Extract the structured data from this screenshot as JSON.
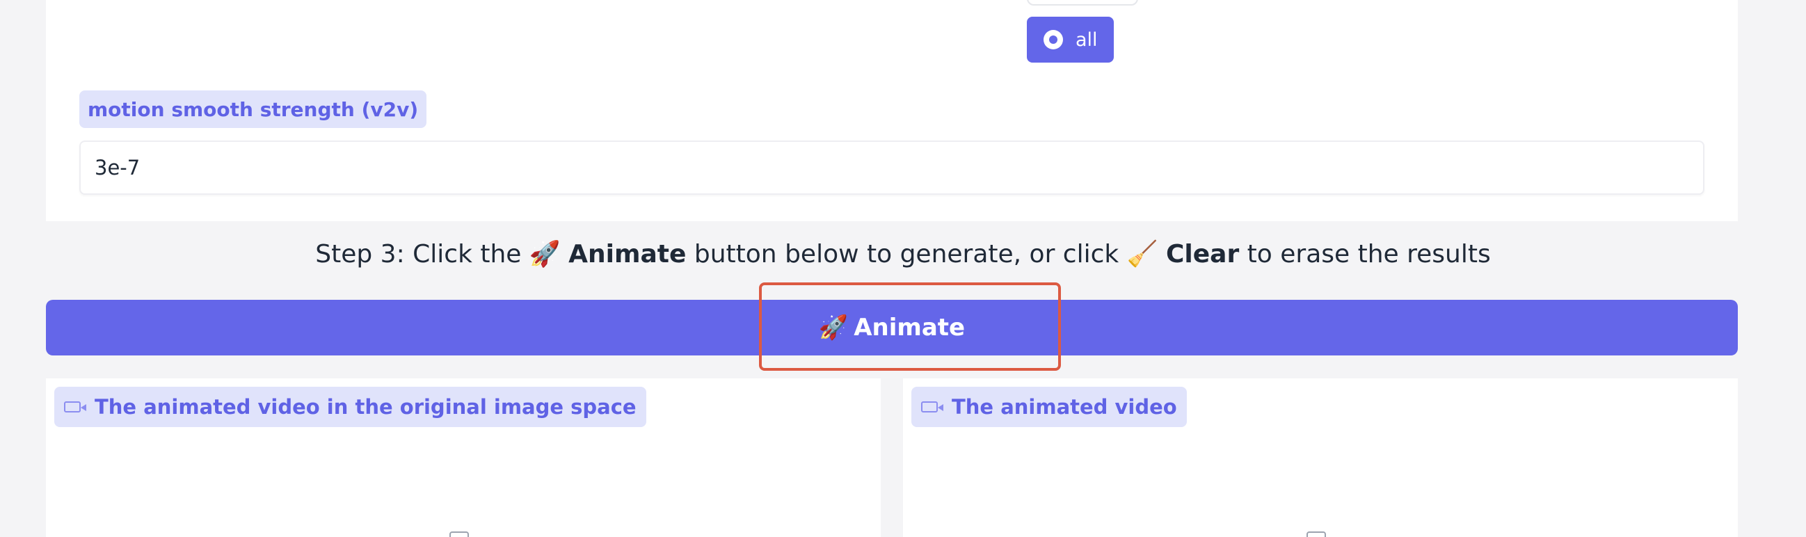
{
  "options": {
    "selected_label": "all"
  },
  "motion_smooth": {
    "label": "motion smooth strength (v2v)",
    "value": "3e-7"
  },
  "step3": {
    "prefix": "Step 3: Click the ",
    "animate_emoji": "🚀",
    "animate_word": "Animate",
    "middle": " button below to generate, or click ",
    "clear_emoji": "🧹",
    "clear_word": "Clear",
    "suffix": " to erase the results"
  },
  "animate_button": {
    "emoji": "🚀",
    "label": "Animate"
  },
  "outputs": {
    "left_label": "The animated video in the original image space",
    "right_label": "The animated video"
  },
  "colors": {
    "accent": "#6466e9",
    "chip_bg": "#e0e3fb",
    "highlight": "#dc5a42"
  }
}
